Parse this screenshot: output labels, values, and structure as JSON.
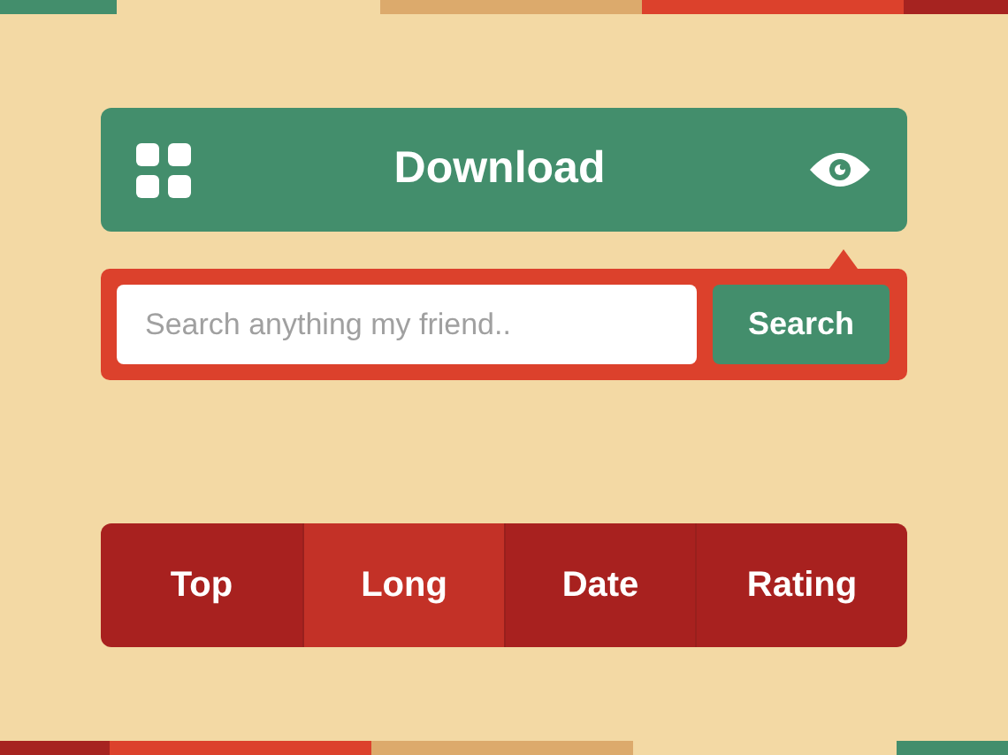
{
  "download_bar": {
    "label": "Download"
  },
  "search": {
    "placeholder": "Search anything my friend..",
    "button": "Search"
  },
  "tabs": [
    {
      "label": "Top",
      "selected": false
    },
    {
      "label": "Long",
      "selected": true
    },
    {
      "label": "Date",
      "selected": false
    },
    {
      "label": "Rating",
      "selected": false
    }
  ]
}
